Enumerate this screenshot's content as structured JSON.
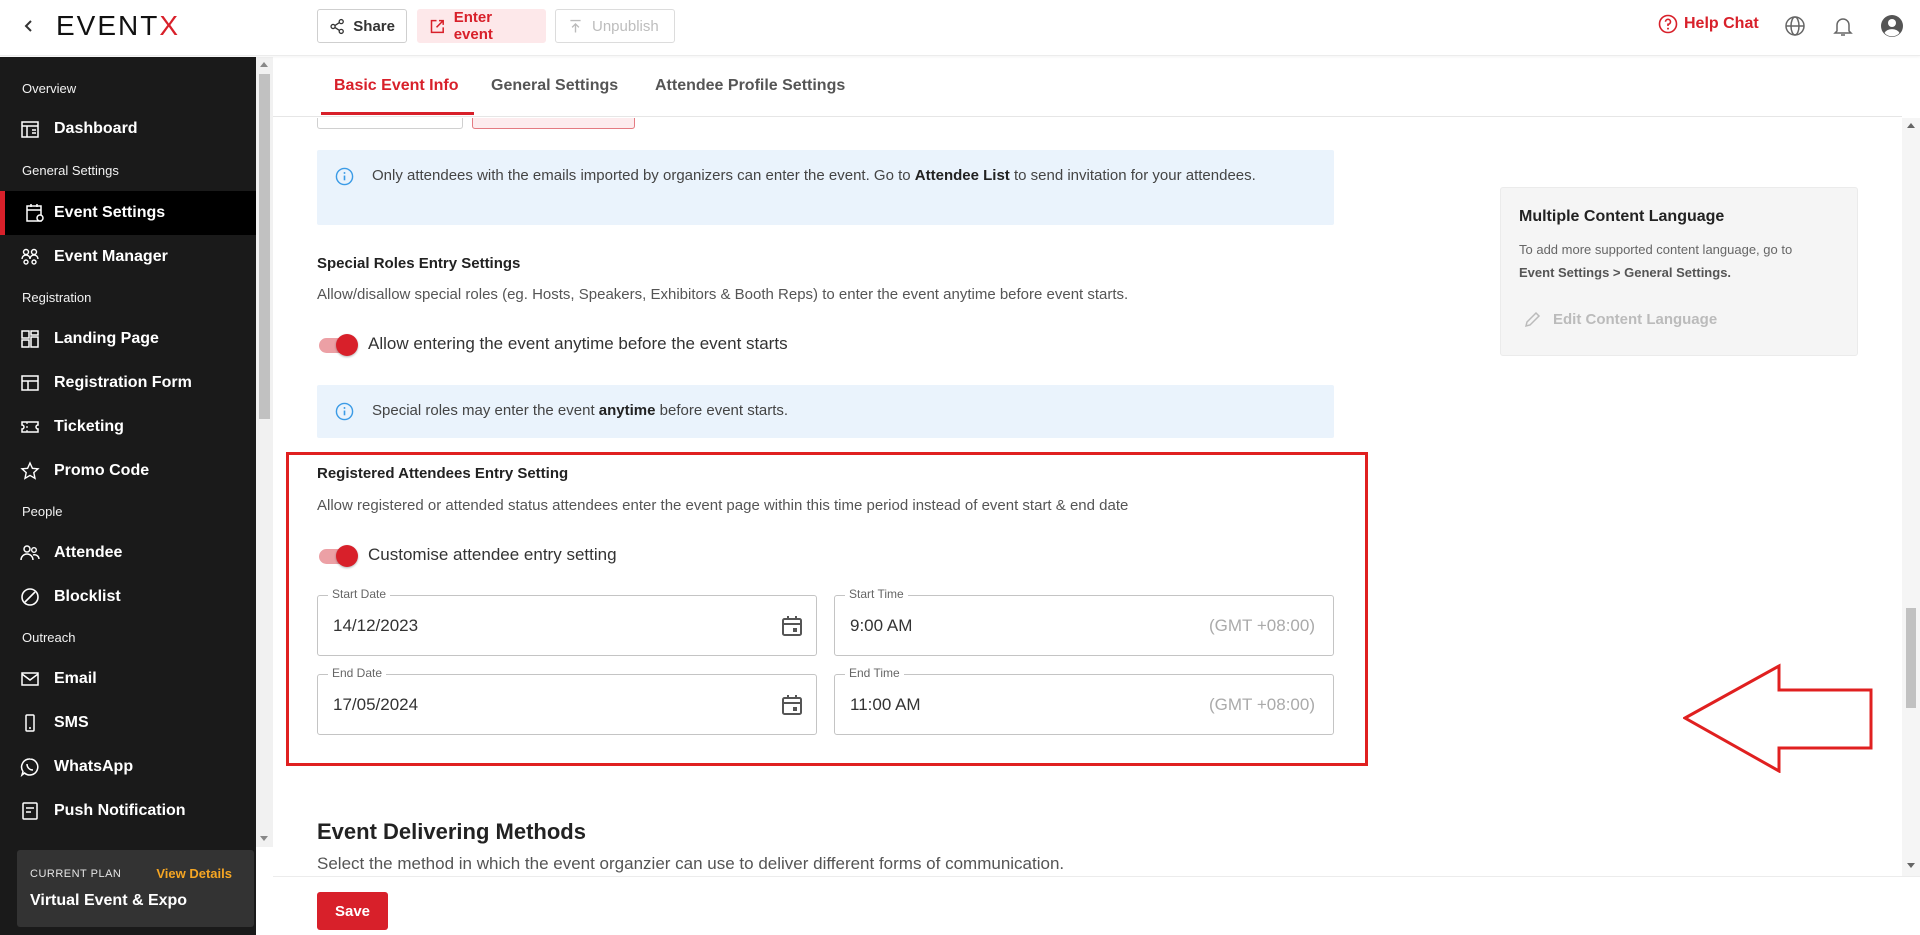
{
  "topbar": {
    "logo_main": "EVENT",
    "logo_x": "X",
    "share_label": "Share",
    "enter_label": "Enter event",
    "unpublish_label": "Unpublish",
    "help_label": "Help Chat"
  },
  "sidebar": {
    "sections": {
      "overview": "Overview",
      "general": "General Settings",
      "registration": "Registration",
      "people": "People",
      "outreach": "Outreach"
    },
    "items": {
      "dashboard": "Dashboard",
      "event_settings": "Event Settings",
      "event_manager": "Event Manager",
      "landing_page": "Landing Page",
      "registration_form": "Registration Form",
      "ticketing": "Ticketing",
      "promo_code": "Promo Code",
      "attendee": "Attendee",
      "blocklist": "Blocklist",
      "email": "Email",
      "sms": "SMS",
      "whatsapp": "WhatsApp",
      "push_notification": "Push Notification"
    },
    "plan": {
      "label": "CURRENT PLAN",
      "view_details": "View Details",
      "name": "Virtual Event & Expo"
    }
  },
  "tabs": {
    "basic": "Basic Event Info",
    "general": "General Settings",
    "attendee_profile": "Attendee Profile Settings"
  },
  "main": {
    "info1": {
      "before": "Only attendees with the emails imported by organizers can enter the event. Go to ",
      "bold": "Attendee List",
      "after": " to send invitation for your attendees."
    },
    "special_roles": {
      "title": "Special Roles Entry Settings",
      "desc": "Allow/disallow special roles (eg. Hosts, Speakers, Exhibitors & Booth Reps) to enter the event anytime before event starts.",
      "toggle_label": "Allow entering the event anytime before the event starts",
      "toggle_on": true
    },
    "info2": {
      "before": "Special roles may enter the event ",
      "bold": "anytime",
      "after": " before event starts."
    },
    "registered": {
      "title": "Registered Attendees Entry Setting",
      "desc": "Allow registered or attended status attendees enter the event page within this time period instead of event start & end date",
      "toggle_label": "Customise attendee entry setting",
      "toggle_on": true,
      "start_date_label": "Start Date",
      "start_date": "14/12/2023",
      "start_time_label": "Start Time",
      "start_time": "9:00 AM",
      "end_date_label": "End Date",
      "end_date": "17/05/2024",
      "end_time_label": "End Time",
      "end_time": "11:00 AM",
      "timezone": "(GMT +08:00)"
    },
    "delivering": {
      "title": "Event Delivering Methods",
      "desc": "Select the method in which the event organzier can use to deliver different forms of communication."
    },
    "side_card": {
      "title": "Multiple Content Language",
      "desc": "To add more supported content language, go to ",
      "desc_bold": "Event Settings > General Settings.",
      "edit": "Edit Content Language"
    }
  },
  "bottom": {
    "save_label": "Save"
  },
  "colors": {
    "brand": "#d8202a",
    "sidebar_bg": "#1a1a1a",
    "info_bg": "#eaf3fc",
    "highlight": "#e02020"
  }
}
